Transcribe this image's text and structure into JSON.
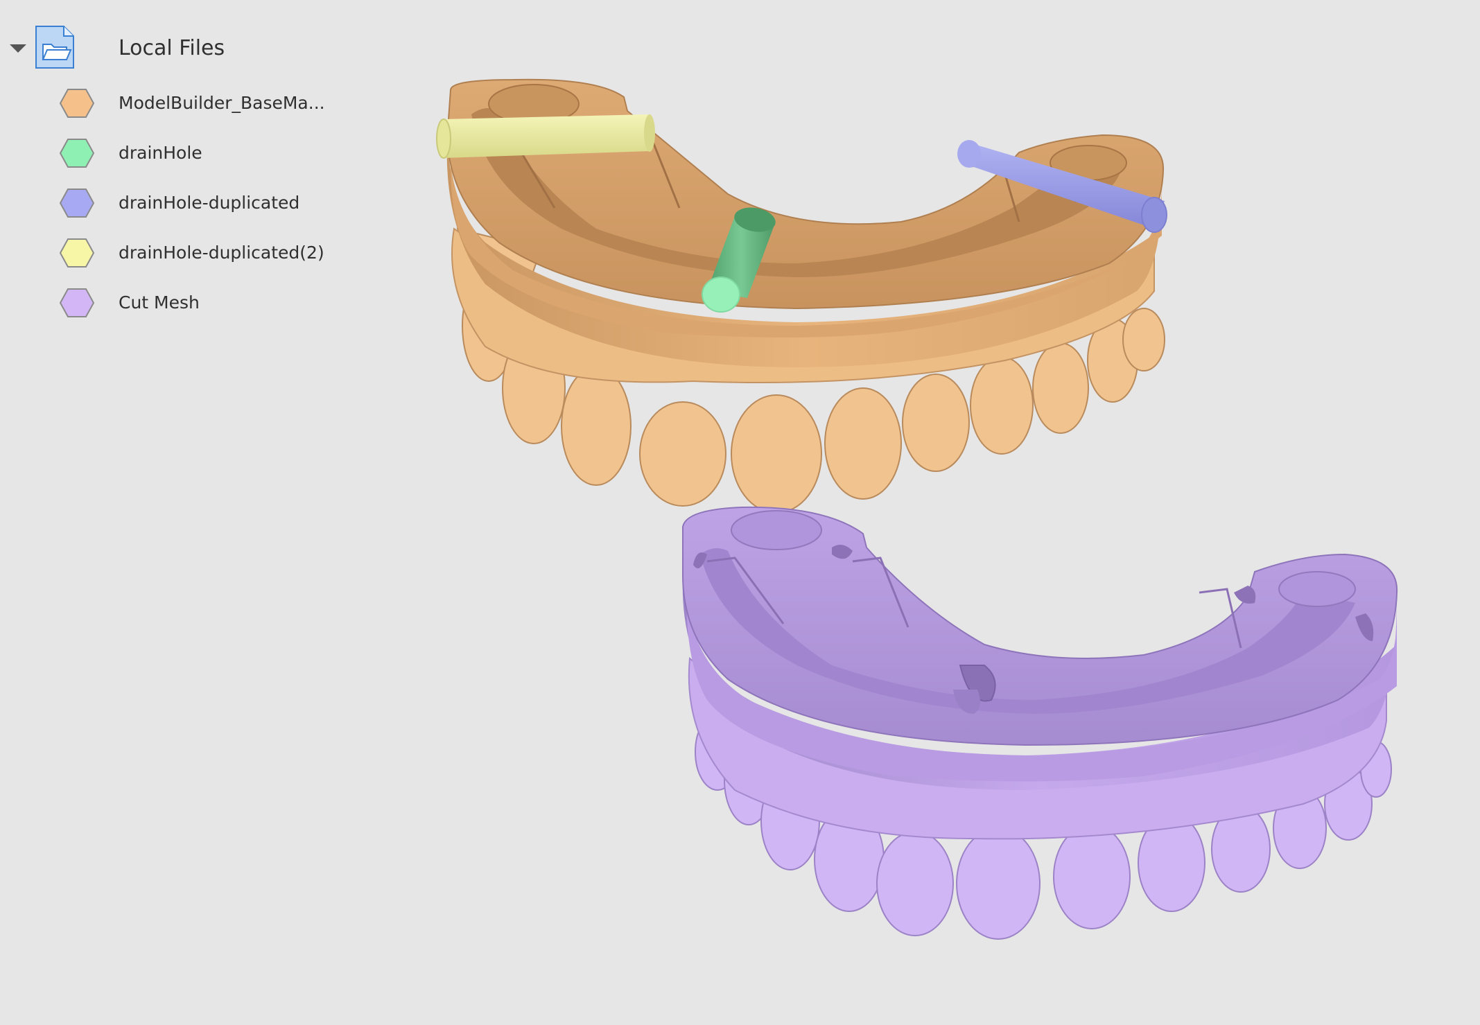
{
  "tree": {
    "root": {
      "label": "Local Files",
      "icon": "folder-icon",
      "expanded": true
    },
    "items": [
      {
        "label": "ModelBuilder_BaseMa...",
        "color": "#f5c089",
        "icon": "hexagon-icon"
      },
      {
        "label": "drainHole",
        "color": "#8ef0b3",
        "icon": "hexagon-icon"
      },
      {
        "label": "drainHole-duplicated",
        "color": "#a8a9f3",
        "icon": "hexagon-icon"
      },
      {
        "label": "drainHole-duplicated(2)",
        "color": "#f6f6a6",
        "icon": "hexagon-icon"
      },
      {
        "label": "Cut Mesh",
        "color": "#d2b6f6",
        "icon": "hexagon-icon"
      }
    ]
  },
  "viewport": {
    "models": [
      {
        "name": "ModelBuilder_BaseMa...",
        "color": "#e9b57c",
        "shade": "#b8875a"
      },
      {
        "name": "Cut Mesh",
        "color": "#c4a7ea",
        "shade": "#9a80c4"
      }
    ],
    "cylinders": [
      {
        "name": "drainHole",
        "color": "#6fbf8a",
        "cap": "#96f0b8"
      },
      {
        "name": "drainHole-duplicated",
        "color": "#a1a4e8",
        "cap": "#b8baf4"
      },
      {
        "name": "drainHole-duplicated(2)",
        "color": "#ecec9c",
        "cap": "#f5f5b6"
      }
    ]
  }
}
